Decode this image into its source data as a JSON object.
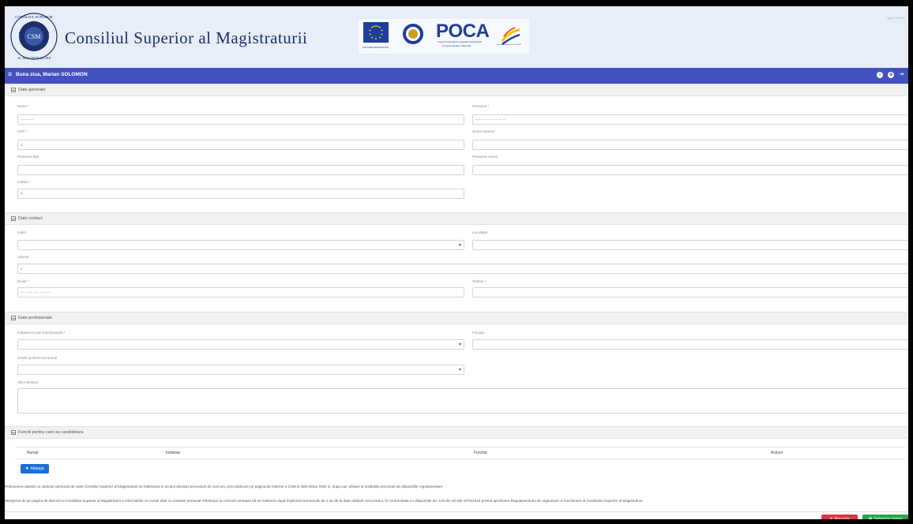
{
  "header": {
    "title": "Consiliul Superior al Magistraturii",
    "seal_text_top": "CONSILIUL SUPERIOR",
    "seal_text_bottom": "AL MAGISTRATURII",
    "seal_center": "CSM",
    "eu_caption": "UNIUNEA EUROPEANĂ",
    "poca_title": "POCA",
    "poca_subtitle": "Programul Operațional Capacitate Administrativă",
    "poca_tagline": "Competența face diferența!",
    "ic_caption": "Instrumente Structurale 2014-2020",
    "version": "ngmd 2024/1"
  },
  "navbar": {
    "greeting": "Buna ziua, Marian SOLOMON"
  },
  "sections": {
    "general": "Date generale",
    "contact": "Date contact",
    "professional": "Date profesionale",
    "positions": "Functii pentru care se candideaza"
  },
  "general": {
    "nume_label": "Nume *",
    "nume_value": "••••••••",
    "prenume_label": "Prenume *",
    "prenume_value": "•••• •••• ••• ••••",
    "cnp_label": "CNP *",
    "cnp_value": "1",
    "nume_anterior_label": "Nume anterior",
    "nume_anterior_value": "",
    "prenume_tata_label": "Prenume tata",
    "prenume_tata_value": "",
    "prenume_mama_label": "Prenume mama",
    "prenume_mama_value": "",
    "initiala_label": "Initiala *",
    "initiala_value": "T"
  },
  "contact": {
    "judet_label": "Judet",
    "judet_value": "",
    "localitate_label": "Localitate",
    "localitate_value": "",
    "adresa_label": "Adresa",
    "adresa_value": "1",
    "email_label": "Email *",
    "email_value": "•• •••• ••• •• •••",
    "telefon_label": "Telefon *",
    "telefon_value": ""
  },
  "professional": {
    "instanta_label": "Instanta la care functioneaza *",
    "instanta_value": "",
    "functia_label": "Functia",
    "functia_value": "",
    "grad_label": "Gradul profesional actual",
    "grad_value": "",
    "alte_label": "Alte mentiuni",
    "alte_value": ""
  },
  "positions_table": {
    "columns": [
      "Numar",
      "Instanta",
      "Functia",
      "Actiuni"
    ],
    "rows": [],
    "add_button": "Adauga"
  },
  "notes": {
    "note1": "Prelucrarea datelor cu caracter personal de catre Consiliul Superior al Magistraturii se realizeaza in scopul derularii procedurii de concurs, prin publicare pe pagina de internet a CSM si INM si/sau SNG si, dupa caz, afisare la institutiile precizate de dispozitiile regulamentare.",
    "note2": "Stergerea de pe pagina de internet a Consiliului Superior al Magistraturii a informatiilor ce contin date cu caracter personal referitoare la concurs urmeaza să se realizeze după împlinirea termenului de 1 an de la data validarii concursului, în conformitate cu dispozițiile art. 140 din HCSM 1073/2018 privind aprobarea Regulamentului de organizare si functionare al Consiliului Superior al Magistraturii."
  },
  "footer": {
    "cancel_label": "Renunta",
    "save_label": "Salveaza cerere"
  },
  "colors": {
    "navbar": "#4351c0",
    "cancel": "#dc3545",
    "save": "#28a745",
    "add": "#1a6fd8"
  }
}
